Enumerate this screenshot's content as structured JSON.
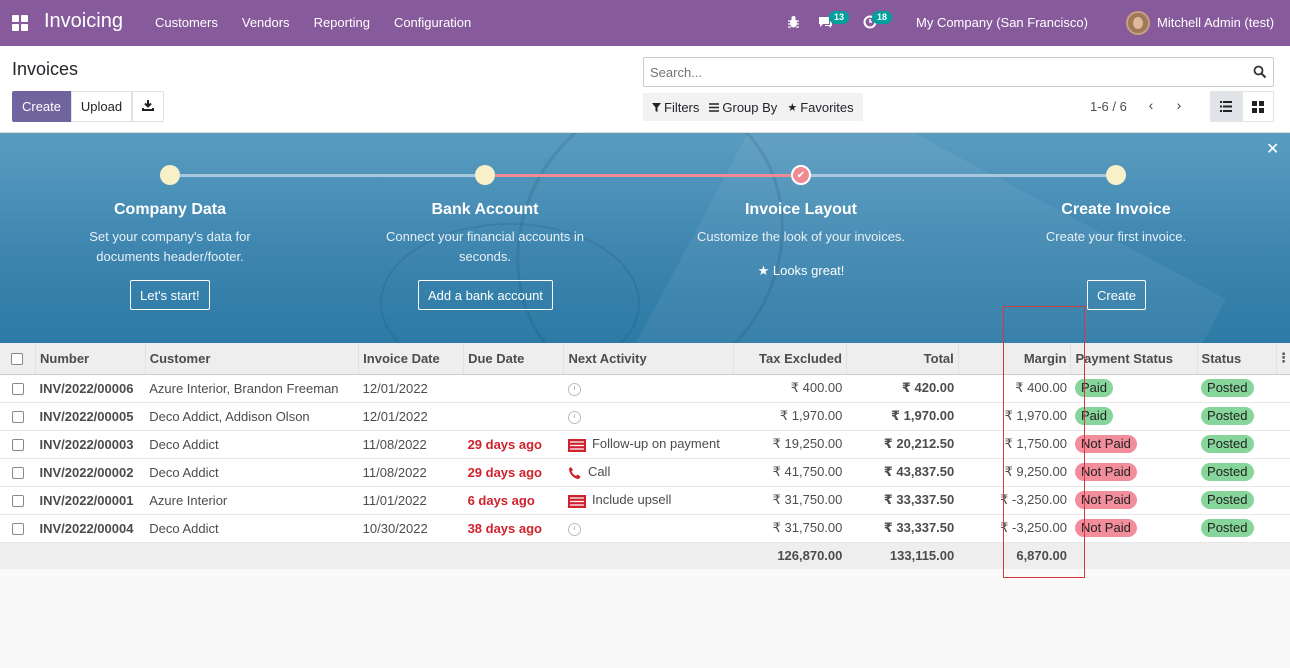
{
  "app": {
    "title": "Invoicing",
    "menu": [
      "Customers",
      "Vendors",
      "Reporting",
      "Configuration"
    ],
    "messages_count": "13",
    "activities_count": "18",
    "company": "My Company (San Francisco)",
    "user": "Mitchell Admin (test)"
  },
  "control_panel": {
    "breadcrumb": "Invoices",
    "create_label": "Create",
    "upload_label": "Upload",
    "search_placeholder": "Search...",
    "filters_label": "Filters",
    "groupby_label": "Group By",
    "favorites_label": "Favorites",
    "pager": "1-6 / 6"
  },
  "onboarding": {
    "steps": [
      {
        "title": "Company Data",
        "desc": "Set your company's data for documents header/footer.",
        "button": "Let's start!"
      },
      {
        "title": "Bank Account",
        "desc": "Connect your financial accounts in seconds.",
        "button": "Add a bank account"
      },
      {
        "title": "Invoice Layout",
        "desc": "Customize the look of your invoices.",
        "done_text": "Looks great!"
      },
      {
        "title": "Create Invoice",
        "desc": "Create your first invoice.",
        "button": "Create"
      }
    ]
  },
  "table": {
    "columns": [
      "Number",
      "Customer",
      "Invoice Date",
      "Due Date",
      "Next Activity",
      "Tax Excluded",
      "Total",
      "Margin",
      "Payment Status",
      "Status"
    ],
    "rows": [
      {
        "number": "INV/2022/00006",
        "customer": "Azure Interior, Brandon Freeman",
        "invoice_date": "12/01/2022",
        "due_date": "",
        "activity": "",
        "activity_icon": "clock-icon",
        "tax_excluded": "₹ 400.00",
        "total": "₹ 420.00",
        "margin": "₹ 400.00",
        "payment_status": "Paid",
        "status": "Posted"
      },
      {
        "number": "INV/2022/00005",
        "customer": "Deco Addict, Addison Olson",
        "invoice_date": "12/01/2022",
        "due_date": "",
        "activity": "",
        "activity_icon": "clock-icon",
        "tax_excluded": "₹ 1,970.00",
        "total": "₹ 1,970.00",
        "margin": "₹ 1,970.00",
        "payment_status": "Paid",
        "status": "Posted"
      },
      {
        "number": "INV/2022/00003",
        "customer": "Deco Addict",
        "invoice_date": "11/08/2022",
        "due_date": "29 days ago",
        "activity": "Follow-up on payment",
        "activity_icon": "list-icon",
        "tax_excluded": "₹ 19,250.00",
        "total": "₹ 20,212.50",
        "margin": "₹ 1,750.00",
        "payment_status": "Not Paid",
        "status": "Posted"
      },
      {
        "number": "INV/2022/00002",
        "customer": "Deco Addict",
        "invoice_date": "11/08/2022",
        "due_date": "29 days ago",
        "activity": "Call",
        "activity_icon": "phone-icon",
        "tax_excluded": "₹ 41,750.00",
        "total": "₹ 43,837.50",
        "margin": "₹ 9,250.00",
        "payment_status": "Not Paid",
        "status": "Posted"
      },
      {
        "number": "INV/2022/00001",
        "customer": "Azure Interior",
        "invoice_date": "11/01/2022",
        "due_date": "6 days ago",
        "activity": "Include upsell",
        "activity_icon": "list-icon",
        "tax_excluded": "₹ 31,750.00",
        "total": "₹ 33,337.50",
        "margin": "₹ -3,250.00",
        "payment_status": "Not Paid",
        "status": "Posted"
      },
      {
        "number": "INV/2022/00004",
        "customer": "Deco Addict",
        "invoice_date": "10/30/2022",
        "due_date": "38 days ago",
        "activity": "",
        "activity_icon": "clock-icon",
        "tax_excluded": "₹ 31,750.00",
        "total": "₹ 33,337.50",
        "margin": "₹ -3,250.00",
        "payment_status": "Not Paid",
        "status": "Posted"
      }
    ],
    "totals": {
      "tax_excluded": "126,870.00",
      "total": "133,115.00",
      "margin": "6,870.00"
    }
  },
  "colors": {
    "navbar": "#875a9b",
    "primary_button": "#71639e",
    "paid": "#86d59a",
    "not_paid": "#f28d9b",
    "overdue": "#d0212c",
    "highlight": "#d9363e"
  }
}
